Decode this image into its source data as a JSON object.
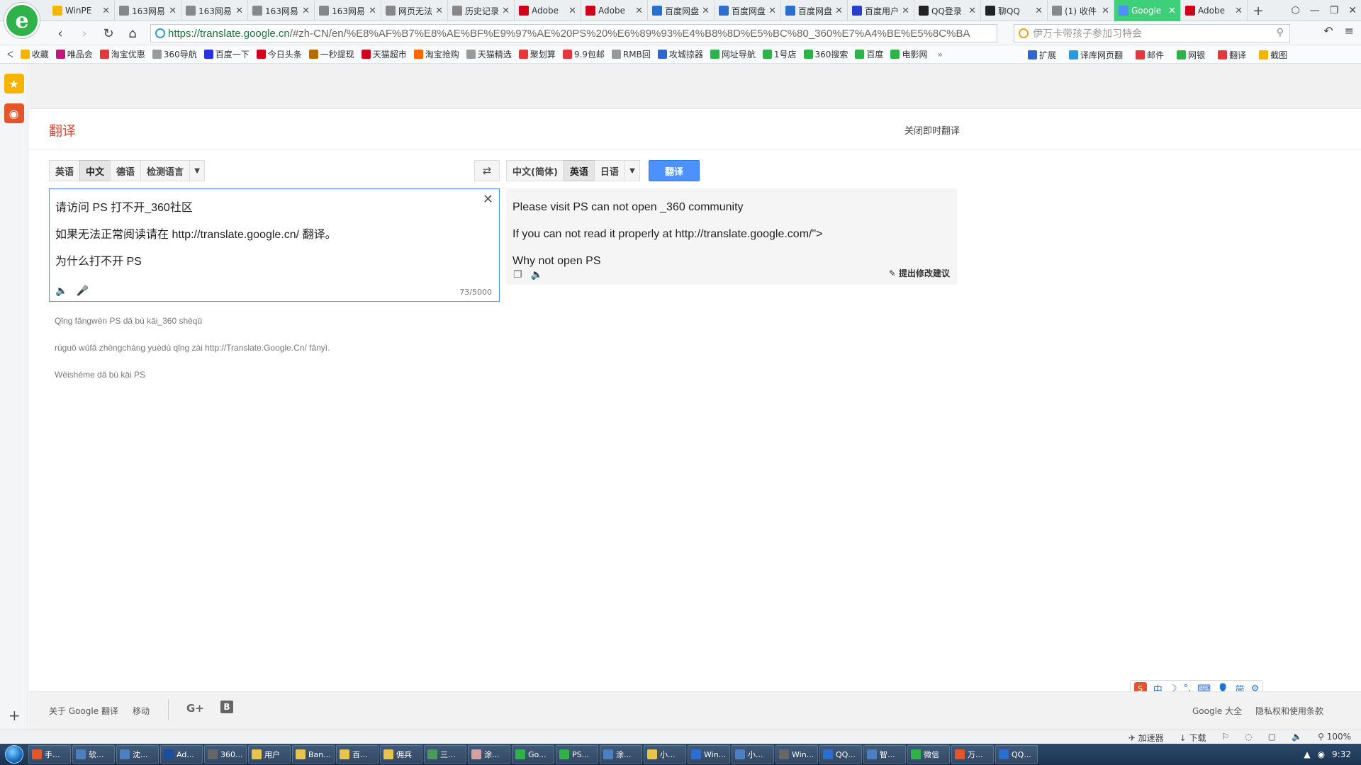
{
  "browser": {
    "logo_letter": "e",
    "tabs": [
      {
        "label": "WinPE",
        "color": "#f2b500"
      },
      {
        "label": "163网易",
        "color": "#888888"
      },
      {
        "label": "163网易",
        "color": "#888888"
      },
      {
        "label": "163网易",
        "color": "#888888"
      },
      {
        "label": "163网易",
        "color": "#888888"
      },
      {
        "label": "网页无法",
        "color": "#888888"
      },
      {
        "label": "历史记录",
        "color": "#888888"
      },
      {
        "label": "Adobe",
        "color": "#d0021b"
      },
      {
        "label": "Adobe",
        "color": "#d0021b"
      },
      {
        "label": "百度网盘",
        "color": "#2a6fd0"
      },
      {
        "label": "百度网盘",
        "color": "#2a6fd0"
      },
      {
        "label": "百度网盘",
        "color": "#2a6fd0"
      },
      {
        "label": "百度用户",
        "color": "#2a3fd0"
      },
      {
        "label": "QQ登录",
        "color": "#222222"
      },
      {
        "label": "聊QQ",
        "color": "#222222"
      },
      {
        "label": "(1) 收件",
        "color": "#888888"
      },
      {
        "label": "Google",
        "color": "#4d90fe",
        "active": true
      },
      {
        "label": "Adobe",
        "color": "#d0021b"
      }
    ],
    "new_tab": "+",
    "window_controls": [
      "⬡",
      "—",
      "❐",
      "✕"
    ],
    "url_host": "https://translate.google.cn",
    "url_rest": "/#zh-CN/en/%E8%AF%B7%E8%AE%BF%E9%97%AE%20PS%20%E6%89%93%E4%B8%8D%E5%BC%80_360%E7%A4%BE%E5%8C%BA",
    "search_placeholder": "伊万卡带孩子参加习特会",
    "bookmarks": [
      {
        "label": "收藏",
        "color": "#f5b400"
      },
      {
        "label": "唯品会",
        "color": "#c2187a"
      },
      {
        "label": "淘宝优惠",
        "color": "#e4393c"
      },
      {
        "label": "360导航",
        "color": "#999999"
      },
      {
        "label": "百度一下",
        "color": "#2932e1"
      },
      {
        "label": "今日头条",
        "color": "#d0021b"
      },
      {
        "label": "一秒提现",
        "color": "#b36b00"
      },
      {
        "label": "天猫超市",
        "color": "#d0021b"
      },
      {
        "label": "淘宝抢购",
        "color": "#ff6600"
      },
      {
        "label": "天猫精选",
        "color": "#999999"
      },
      {
        "label": "聚划算",
        "color": "#e4393c"
      },
      {
        "label": "9.9包邮",
        "color": "#e4393c"
      },
      {
        "label": "RMB回",
        "color": "#999999"
      },
      {
        "label": "攻城掠器",
        "color": "#3366cc"
      },
      {
        "label": "网址导航",
        "color": "#2fb24a"
      },
      {
        "label": "1号店",
        "color": "#2fb24a"
      },
      {
        "label": "360搜索",
        "color": "#2fb24a"
      },
      {
        "label": "百度",
        "color": "#2fb24a"
      },
      {
        "label": "电影网",
        "color": "#2fb24a"
      }
    ],
    "bookmarks_right": [
      {
        "label": "扩展",
        "color": "#3366cc"
      },
      {
        "label": "译库网页翻",
        "color": "#2a9ad8"
      },
      {
        "label": "邮件",
        "color": "#e4393c"
      },
      {
        "label": "网银",
        "color": "#2fb24a"
      },
      {
        "label": "翻译",
        "color": "#e4393c"
      },
      {
        "label": "截图",
        "color": "#f5b400"
      }
    ]
  },
  "page": {
    "title": "翻译",
    "instant_toggle": "关闭即时翻译",
    "source_langs": [
      "英语",
      "中文",
      "德语",
      "检测语言"
    ],
    "target_langs": [
      "中文(简体)",
      "英语",
      "日语"
    ],
    "translate_button": "翻译",
    "source_lines": [
      "请访问 PS 打不开_360社区",
      "如果无法正常阅读请在 http://translate.google.cn/ 翻译。",
      "为什么打不开 PS"
    ],
    "char_count": "73/5000",
    "result_lines": [
      "Please visit PS can not open _360 community",
      "If you can not read it properly at http://translate.google.com/\">",
      "Why not open PS"
    ],
    "suggest_edit": "提出修改建议",
    "transliteration": [
      "Qǐng fǎngwèn PS dǎ bù kāi_360 shèqū",
      "rúguǒ wúfǎ zhèngcháng yuèdú qǐng zài http://Translate.Google.Cn/ fānyì.",
      "Wèishéme dǎ bù kāi PS"
    ]
  },
  "ime": {
    "logo": "S",
    "items": [
      "中",
      "☽",
      "°,",
      "⌨",
      "👤",
      "简",
      "⚙"
    ]
  },
  "footer": {
    "about": "关于 Google 翻译",
    "mobile": "移动",
    "gplus": "G+",
    "blogger": "B",
    "google_all": "Google 大全",
    "privacy": "隐私权和使用条款"
  },
  "statusbar": {
    "accelerator": "加速器",
    "download": "下载",
    "zoom": "100%"
  },
  "taskbar": {
    "tasks": [
      {
        "label": "手...",
        "color": "#e5552a"
      },
      {
        "label": "软...",
        "color": "#4a7fc1"
      },
      {
        "label": "沈...",
        "color": "#4a7fc1"
      },
      {
        "label": "Ad...",
        "color": "#1a4fa0"
      },
      {
        "label": "360...",
        "color": "#666666"
      },
      {
        "label": "用户",
        "color": "#e8c44a"
      },
      {
        "label": "Ban...",
        "color": "#e8c44a"
      },
      {
        "label": "百...",
        "color": "#e8c44a"
      },
      {
        "label": "佣兵",
        "color": "#e8c44a"
      },
      {
        "label": "三...",
        "color": "#4a9a5a"
      },
      {
        "label": "涂...",
        "color": "#d4a0a0"
      },
      {
        "label": "Go...",
        "color": "#2fb24a"
      },
      {
        "label": "PS...",
        "color": "#2fb24a"
      },
      {
        "label": "涂...",
        "color": "#4a7fc1"
      },
      {
        "label": "小...",
        "color": "#e8c44a"
      },
      {
        "label": "Win...",
        "color": "#2a6fd0"
      },
      {
        "label": "小...",
        "color": "#4a7fc1"
      },
      {
        "label": "Win...",
        "color": "#666666"
      },
      {
        "label": "QQ...",
        "color": "#2a6fd0"
      },
      {
        "label": "智...",
        "color": "#4a7fc1"
      },
      {
        "label": "微信",
        "color": "#2fb24a"
      },
      {
        "label": "万...",
        "color": "#e5552a"
      },
      {
        "label": "QQ...",
        "color": "#2a6fd0"
      }
    ],
    "clock": "9:32"
  }
}
